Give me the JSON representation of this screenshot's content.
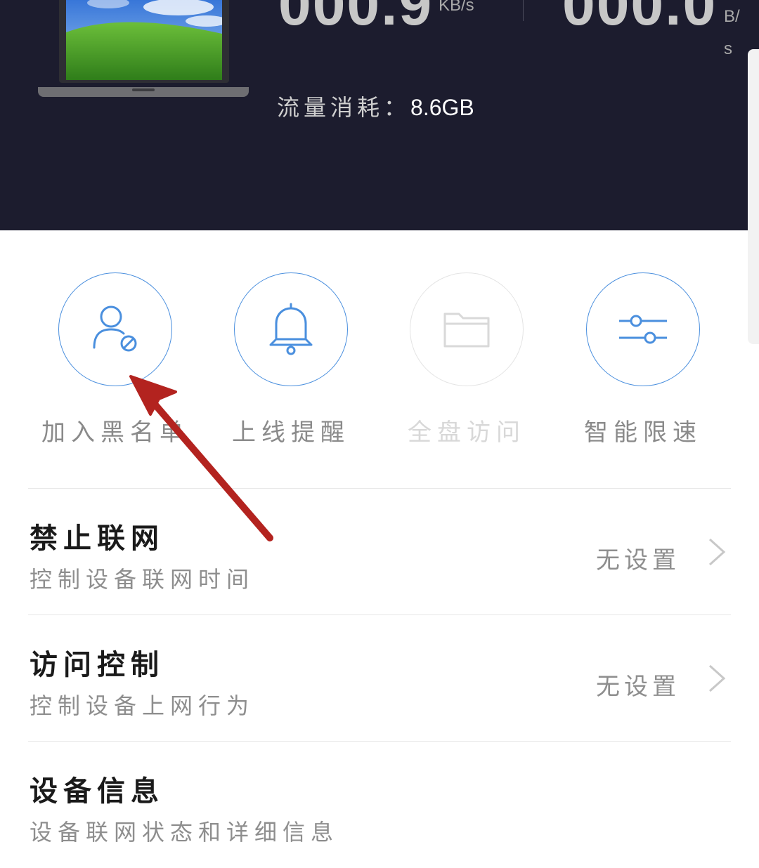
{
  "header": {
    "download_speed": "000.9",
    "download_unit": "KB/s",
    "upload_speed": "000.0",
    "upload_unit_part1": "B/",
    "upload_unit_part2": "s",
    "traffic_label": "流量消耗：",
    "traffic_value": "8.6GB"
  },
  "actions": [
    {
      "label": "加入黑名单",
      "icon": "user-block-icon",
      "enabled": true
    },
    {
      "label": "上线提醒",
      "icon": "bell-icon",
      "enabled": true
    },
    {
      "label": "全盘访问",
      "icon": "folder-icon",
      "enabled": false
    },
    {
      "label": "智能限速",
      "icon": "sliders-icon",
      "enabled": true
    }
  ],
  "rows": [
    {
      "title": "禁止联网",
      "subtitle": "控制设备联网时间",
      "status": "无设置"
    },
    {
      "title": "访问控制",
      "subtitle": "控制设备上网行为",
      "status": "无设置"
    },
    {
      "title": "设备信息",
      "subtitle": "设备联网状态和详细信息",
      "status": ""
    }
  ],
  "colors": {
    "header_bg": "#1c1c2e",
    "accent": "#4a8fde",
    "annotation_arrow": "#b3231f"
  }
}
